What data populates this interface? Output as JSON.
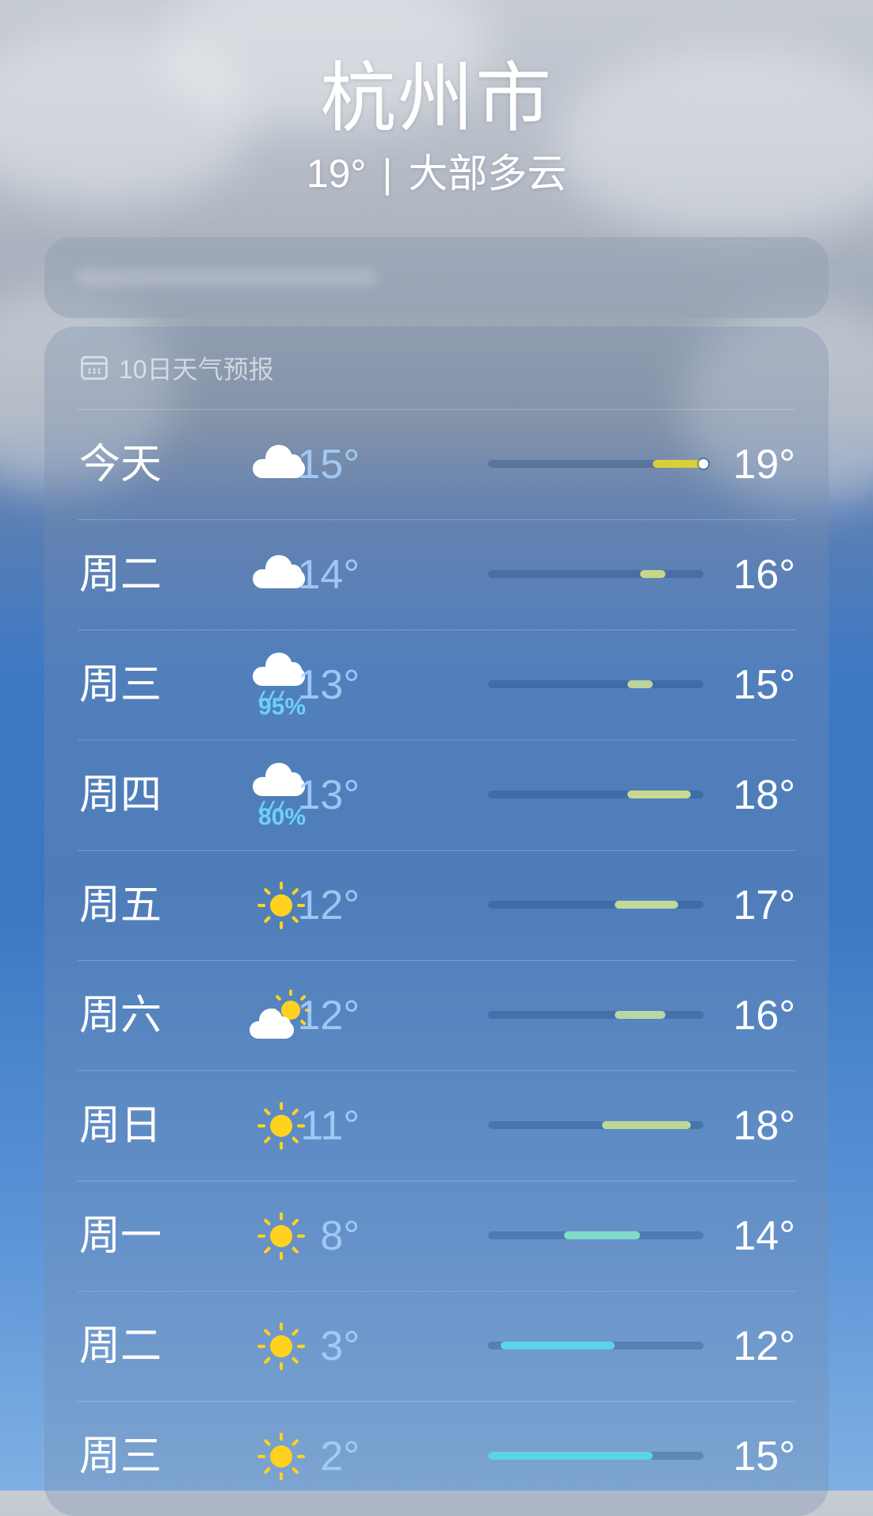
{
  "header": {
    "city": "杭州市",
    "current_temp": "19°",
    "separator": "|",
    "condition": "大部多云"
  },
  "forecast": {
    "title": "10日天气预报",
    "title_icon": "calendar-icon",
    "range_min": 2,
    "range_max": 19,
    "current": 19,
    "days": [
      {
        "day": "今天",
        "icon": "cloud",
        "pop": "",
        "low": "15°",
        "high": "19°",
        "lo": 15,
        "hi": 19,
        "color": "#d8cf3c",
        "now": true
      },
      {
        "day": "周二",
        "icon": "cloud",
        "pop": "",
        "low": "14°",
        "high": "16°",
        "lo": 14,
        "hi": 16,
        "color": "#c8d68a"
      },
      {
        "day": "周三",
        "icon": "rain",
        "pop": "95%",
        "low": "13°",
        "high": "15°",
        "lo": 13,
        "hi": 15,
        "color": "#bcd59c"
      },
      {
        "day": "周四",
        "icon": "rain",
        "pop": "80%",
        "low": "13°",
        "high": "18°",
        "lo": 13,
        "hi": 18,
        "color": "#c9d890"
      },
      {
        "day": "周五",
        "icon": "sun",
        "pop": "",
        "low": "12°",
        "high": "17°",
        "lo": 12,
        "hi": 17,
        "color": "#bfd99a"
      },
      {
        "day": "周六",
        "icon": "partly-cloudy",
        "pop": "",
        "low": "12°",
        "high": "16°",
        "lo": 12,
        "hi": 16,
        "color": "#b8d8a2"
      },
      {
        "day": "周日",
        "icon": "sun",
        "pop": "",
        "low": "11°",
        "high": "18°",
        "lo": 11,
        "hi": 18,
        "color": "#bcd79a"
      },
      {
        "day": "周一",
        "icon": "sun",
        "pop": "",
        "low": "8°",
        "high": "14°",
        "lo": 8,
        "hi": 14,
        "color": "#7fdcc8"
      },
      {
        "day": "周二",
        "icon": "sun",
        "pop": "",
        "low": "3°",
        "high": "12°",
        "lo": 3,
        "hi": 12,
        "color": "#5ad4e6"
      },
      {
        "day": "周三",
        "icon": "sun",
        "pop": "",
        "low": "2°",
        "high": "15°",
        "lo": 2,
        "hi": 15,
        "color": "#5ad4e6"
      }
    ]
  }
}
